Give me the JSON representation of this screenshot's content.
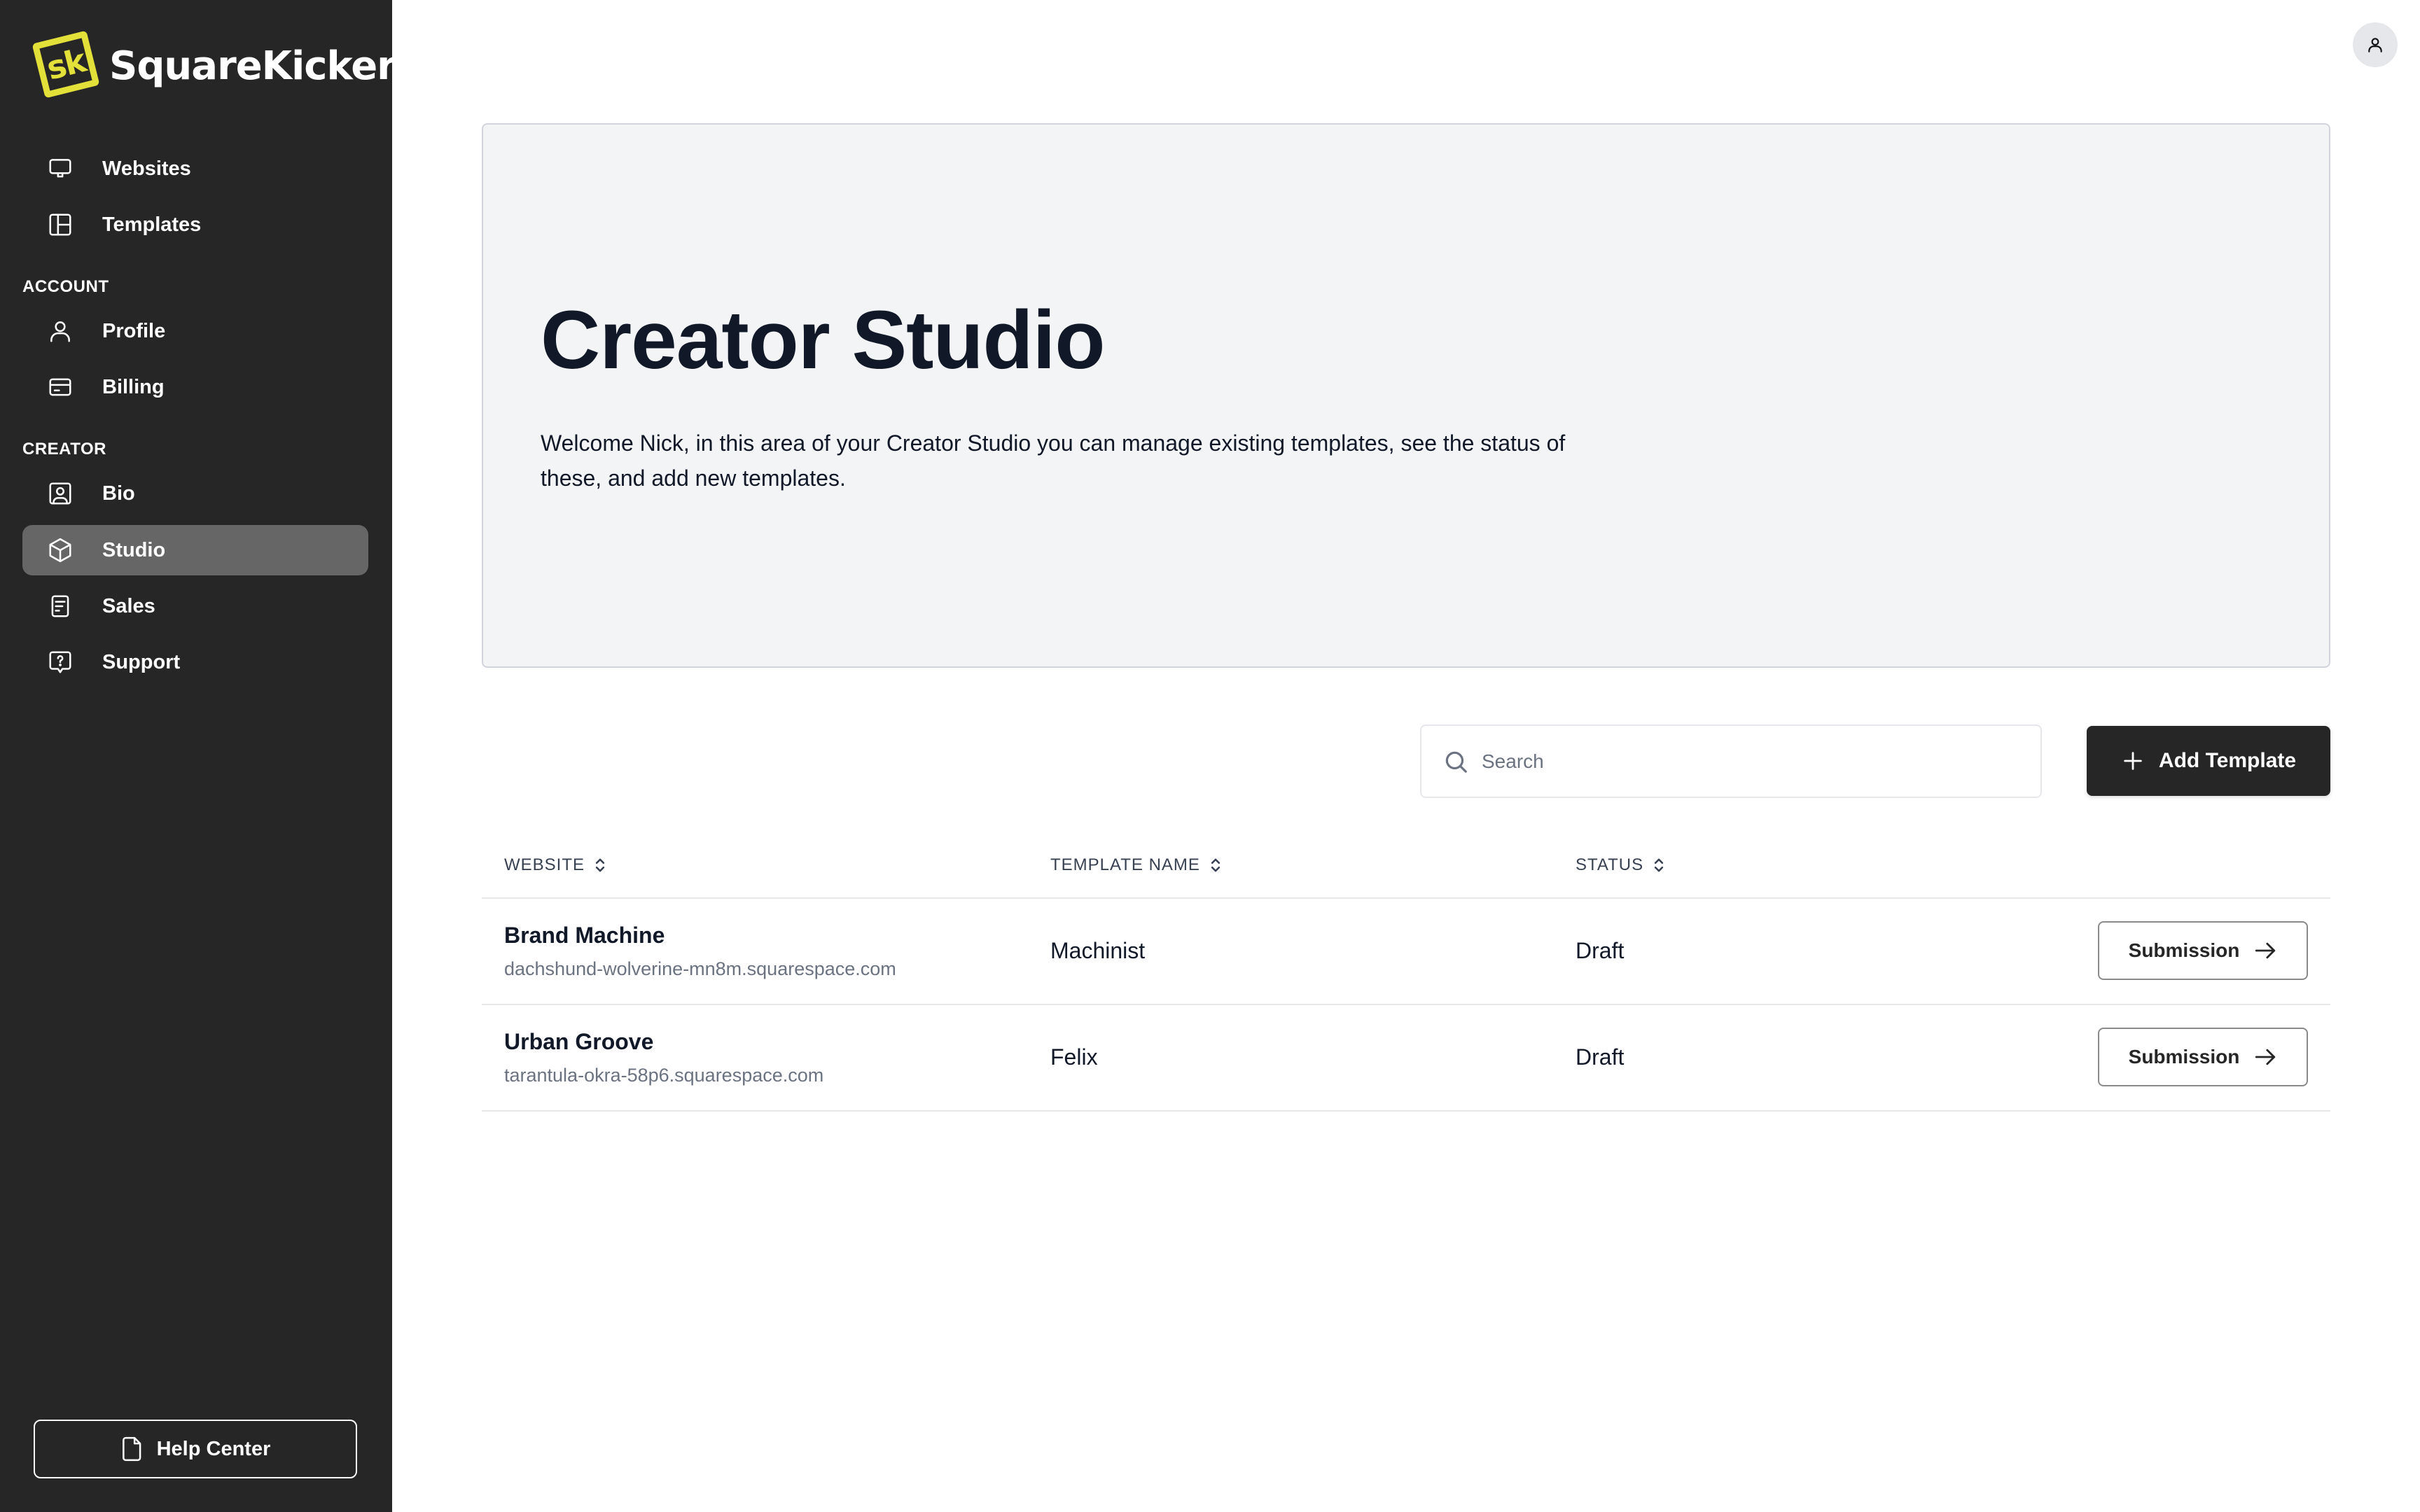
{
  "brand": {
    "logo_mark": "sk",
    "name": "SquareKicker",
    "accent_color": "#e4e03a"
  },
  "sidebar": {
    "items_top": [
      {
        "label": "Websites",
        "icon": "monitor-icon"
      },
      {
        "label": "Templates",
        "icon": "layout-icon"
      }
    ],
    "sections": [
      {
        "title": "ACCOUNT",
        "items": [
          {
            "label": "Profile",
            "icon": "user-icon"
          },
          {
            "label": "Billing",
            "icon": "credit-card-icon"
          }
        ]
      },
      {
        "title": "CREATOR",
        "items": [
          {
            "label": "Bio",
            "icon": "user-square-icon"
          },
          {
            "label": "Studio",
            "icon": "cube-icon",
            "active": true
          },
          {
            "label": "Sales",
            "icon": "receipt-icon"
          },
          {
            "label": "Support",
            "icon": "help-message-icon"
          }
        ]
      }
    ],
    "help_center": {
      "label": "Help Center",
      "icon": "file-icon"
    }
  },
  "header": {
    "avatar_icon": "user-icon"
  },
  "hero": {
    "title": "Creator Studio",
    "description": "Welcome Nick, in this area of your Creator Studio you can manage existing templates, see the status of these, and add new templates."
  },
  "toolbar": {
    "search": {
      "placeholder": "Search",
      "value": ""
    },
    "add_button": "Add Template"
  },
  "table": {
    "columns": [
      "WEBSITE",
      "TEMPLATE NAME",
      "STATUS"
    ],
    "rows": [
      {
        "website_name": "Brand Machine",
        "website_url": "dachshund-wolverine-mn8m.squarespace.com",
        "template_name": "Machinist",
        "status": "Draft",
        "action": "Submission"
      },
      {
        "website_name": "Urban Groove",
        "website_url": "tarantula-okra-58p6.squarespace.com",
        "template_name": "Felix",
        "status": "Draft",
        "action": "Submission"
      }
    ]
  }
}
